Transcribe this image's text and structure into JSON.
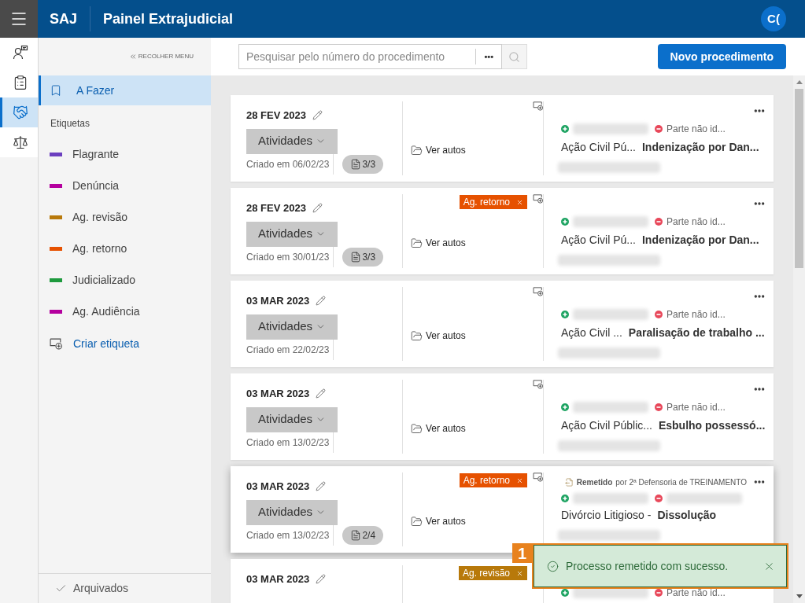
{
  "header": {
    "brand": "SAJ",
    "title": "Painel Extrajudicial",
    "avatar": "C("
  },
  "rail": [
    {
      "kind": "people",
      "selected": false
    },
    {
      "kind": "tasks",
      "selected": false
    },
    {
      "kind": "deals",
      "selected": true
    },
    {
      "kind": "justice",
      "selected": false
    }
  ],
  "sidebar": {
    "collapse": "RECOLHER MENU",
    "items": [
      {
        "label": "A Fazer",
        "selected": true
      }
    ],
    "labels_heading": "Etiquetas",
    "labels": [
      {
        "label": "Flagrante",
        "color": "#6b3fbf"
      },
      {
        "label": "Denúncia",
        "color": "#b4009e"
      },
      {
        "label": "Ag. revisão",
        "color": "#b8790a"
      },
      {
        "label": "Ag. retorno",
        "color": "#e65100"
      },
      {
        "label": "Judicializado",
        "color": "#1e9a3e"
      },
      {
        "label": "Ag. Audiência",
        "color": "#b4009e"
      }
    ],
    "create_label": "Criar etiqueta",
    "archived": "Arquivados"
  },
  "toolbar": {
    "search_placeholder": "Pesquisar pelo número do procedimento",
    "more": "•••",
    "new_button": "Novo procedimento"
  },
  "cards": [
    {
      "date": "28 FEV 2023",
      "activities": "Atividades",
      "created": "Criado em 06/02/23",
      "docs": "3/3",
      "view": "Ver autos",
      "actions": true,
      "highlighted": false,
      "parties": [
        {
          "kind": "active"
        },
        {
          "kind": "passive",
          "name": "Parte não id..."
        }
      ],
      "class": "Ação Civil Pú...",
      "subject": "Indenização por Dan..."
    },
    {
      "date": "28 FEV 2023",
      "activities": "Atividades",
      "created": "Criado em 30/01/23",
      "docs": "3/3",
      "view": "Ver autos",
      "tag": {
        "label": "Ag. retorno",
        "color": "#e65100"
      },
      "actions": true,
      "highlighted": false,
      "parties": [
        {
          "kind": "active"
        },
        {
          "kind": "passive",
          "name": "Parte não id..."
        }
      ],
      "class": "Ação Civil Pú...",
      "subject": "Indenização por Dan..."
    },
    {
      "date": "03 MAR 2023",
      "activities": "Atividades",
      "created": "Criado em 22/02/23",
      "view": "Ver autos",
      "actions": true,
      "highlighted": false,
      "parties": [
        {
          "kind": "active"
        },
        {
          "kind": "passive",
          "name": "Parte não id..."
        }
      ],
      "class": "Ação Civil ...",
      "subject": "Paralisação de trabalho ..."
    },
    {
      "date": "03 MAR 2023",
      "activities": "Atividades",
      "created": "Criado em 13/02/23",
      "view": "Ver autos",
      "actions": true,
      "highlighted": false,
      "parties": [
        {
          "kind": "active"
        },
        {
          "kind": "passive",
          "name": "Parte não id..."
        }
      ],
      "class": "Ação Civil Públic...",
      "subject": "Esbulho possessó..."
    },
    {
      "date": "03 MAR 2023",
      "activities": "Atividades",
      "created": "Criado em 13/02/23",
      "docs": "2/4",
      "view": "Ver autos",
      "tag": {
        "label": "Ag. retorno",
        "color": "#e65100"
      },
      "actions": true,
      "highlighted": true,
      "sent": {
        "status": "Remetido",
        "by": "por 2ª Defensoria de TREINAMENTO"
      },
      "parties": [
        {
          "kind": "active"
        },
        {
          "kind": "passive"
        }
      ],
      "class": "Divórcio Litigioso -",
      "subject": "Dissolução"
    },
    {
      "date": "03 MAR 2023",
      "tag": {
        "label": "Ag. revisão",
        "color": "#b8790a"
      },
      "highlighted": false,
      "parties": [
        {
          "kind": "active"
        },
        {
          "kind": "passive",
          "name": "Parte não id..."
        }
      ]
    }
  ],
  "toast": {
    "callout": "1",
    "message": "Processo remetido com sucesso."
  }
}
